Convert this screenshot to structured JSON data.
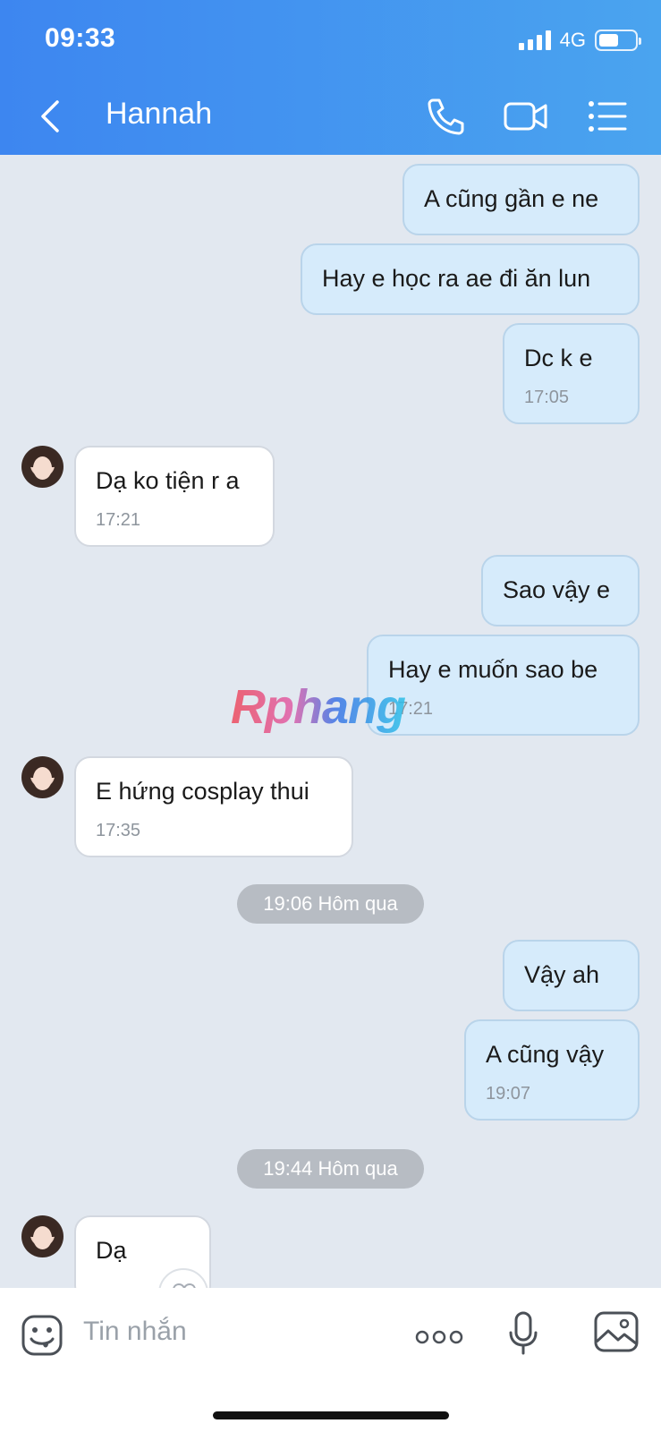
{
  "status_bar": {
    "time": "09:33",
    "network": "4G"
  },
  "header": {
    "contact_name": "Hannah"
  },
  "messages": [
    {
      "dir": "out",
      "text": "A cũng gần e ne",
      "time": ""
    },
    {
      "dir": "out",
      "text": "Hay e học ra ae đi ăn lun",
      "time": ""
    },
    {
      "dir": "out",
      "text": "Dc k e",
      "time": "17:05"
    },
    {
      "dir": "in",
      "text": "Dạ ko tiện r a",
      "time": "17:21"
    },
    {
      "dir": "out",
      "text": "Sao vậy e",
      "time": ""
    },
    {
      "dir": "out",
      "text": "Hay e muốn sao be",
      "time": "17:21"
    },
    {
      "dir": "in",
      "text": "E hứng cosplay thui",
      "time": "17:35"
    },
    {
      "dir": "out",
      "text": "Vậy ah",
      "time": ""
    },
    {
      "dir": "out",
      "text": "A cũng vậy",
      "time": "19:07"
    },
    {
      "dir": "in",
      "text": "Dạ",
      "time": ""
    }
  ],
  "date_separators": [
    "19:06 Hôm qua",
    "19:44 Hôm qua"
  ],
  "watermark": "Rphang",
  "input": {
    "placeholder": "Tin nhắn"
  },
  "colors": {
    "header_start": "#3d86f0",
    "header_end": "#4aa4ef",
    "outgoing_bubble": "#d6ebfb",
    "incoming_bubble": "#ffffff",
    "chat_bg": "#e2e8f0"
  },
  "icons": [
    "back-icon",
    "phone-icon",
    "video-call-icon",
    "menu-list-icon",
    "sticker-icon",
    "more-icon",
    "microphone-icon",
    "image-icon",
    "heart-icon"
  ]
}
